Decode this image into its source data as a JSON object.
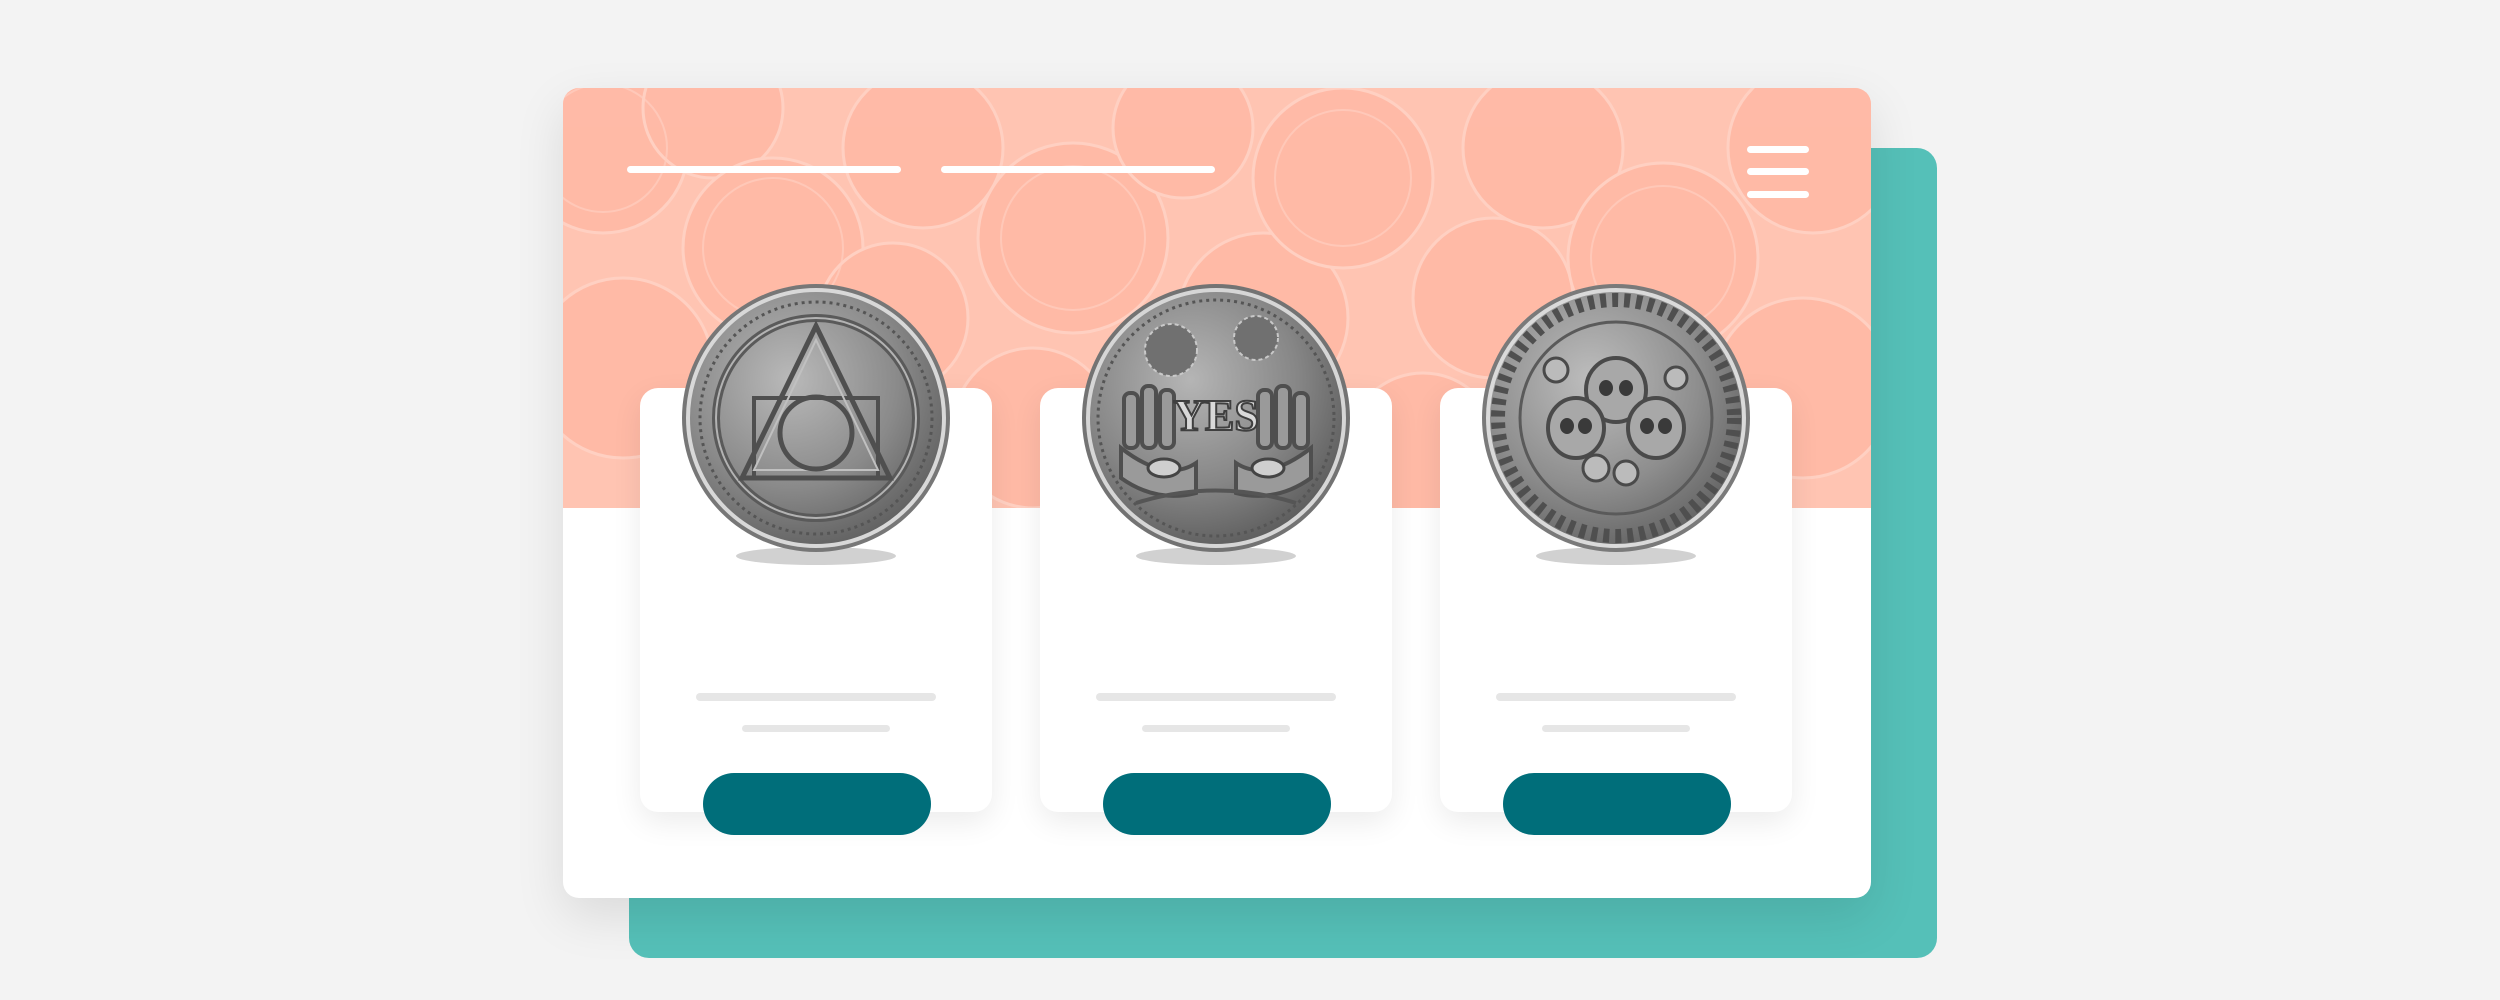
{
  "colors": {
    "page_background": "#f3f3f3",
    "backplate": "#55c0b8",
    "window": "#ffffff",
    "hero": "#ffc4b2",
    "hero_pattern": "#ffb8a3",
    "card_bar": "#e6e6e6",
    "button": "#006e7a"
  },
  "hero": {
    "background": "coin-pattern",
    "nav_links": [
      "nav-link-1",
      "nav-link-2"
    ],
    "menu_icon": "hamburger-icon"
  },
  "cards": [
    {
      "id": "coin-1",
      "coin": "philosophers-stone-coin",
      "engraving": ""
    },
    {
      "id": "coin-2",
      "coin": "yes-no-decision-coin",
      "engraving": "YES"
    },
    {
      "id": "coin-3",
      "coin": "skulls-coin",
      "engraving": ""
    }
  ]
}
